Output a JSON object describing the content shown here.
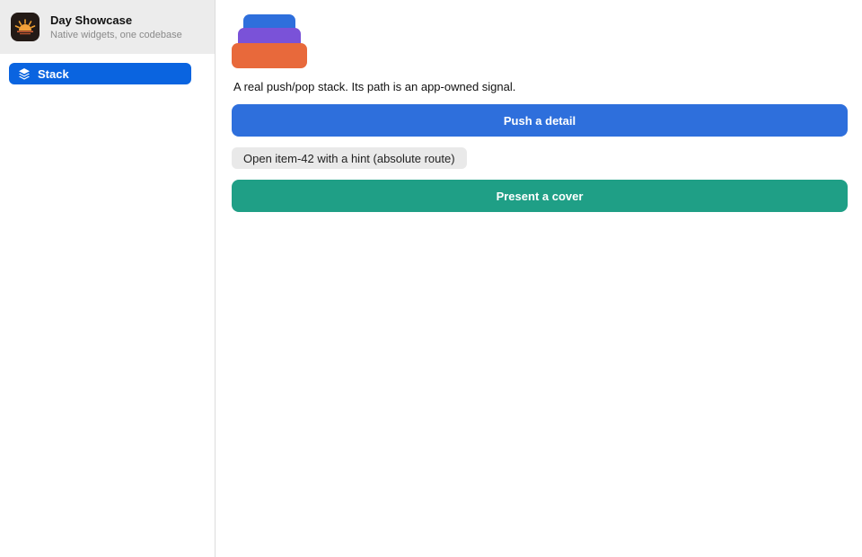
{
  "sidebar": {
    "app_title": "Day Showcase",
    "app_subtitle": "Native widgets, one codebase",
    "app_icon": "sunrise-icon",
    "items": [
      {
        "label": "Stack",
        "icon": "layers-icon",
        "selected": true
      }
    ]
  },
  "main": {
    "illustration_icon": "stack-layers-icon",
    "description": "A real push/pop stack. Its path is an app-owned signal.",
    "push_button_label": "Push a detail",
    "open_item_button_label": "Open item-42 with a hint (absolute route)",
    "present_cover_button_label": "Present a cover"
  },
  "colors": {
    "accent_blue": "#2e6fdc",
    "sidebar_selected": "#0a64e0",
    "teal": "#1f9f86",
    "purple": "#7a52d8",
    "orange": "#e8693b"
  }
}
